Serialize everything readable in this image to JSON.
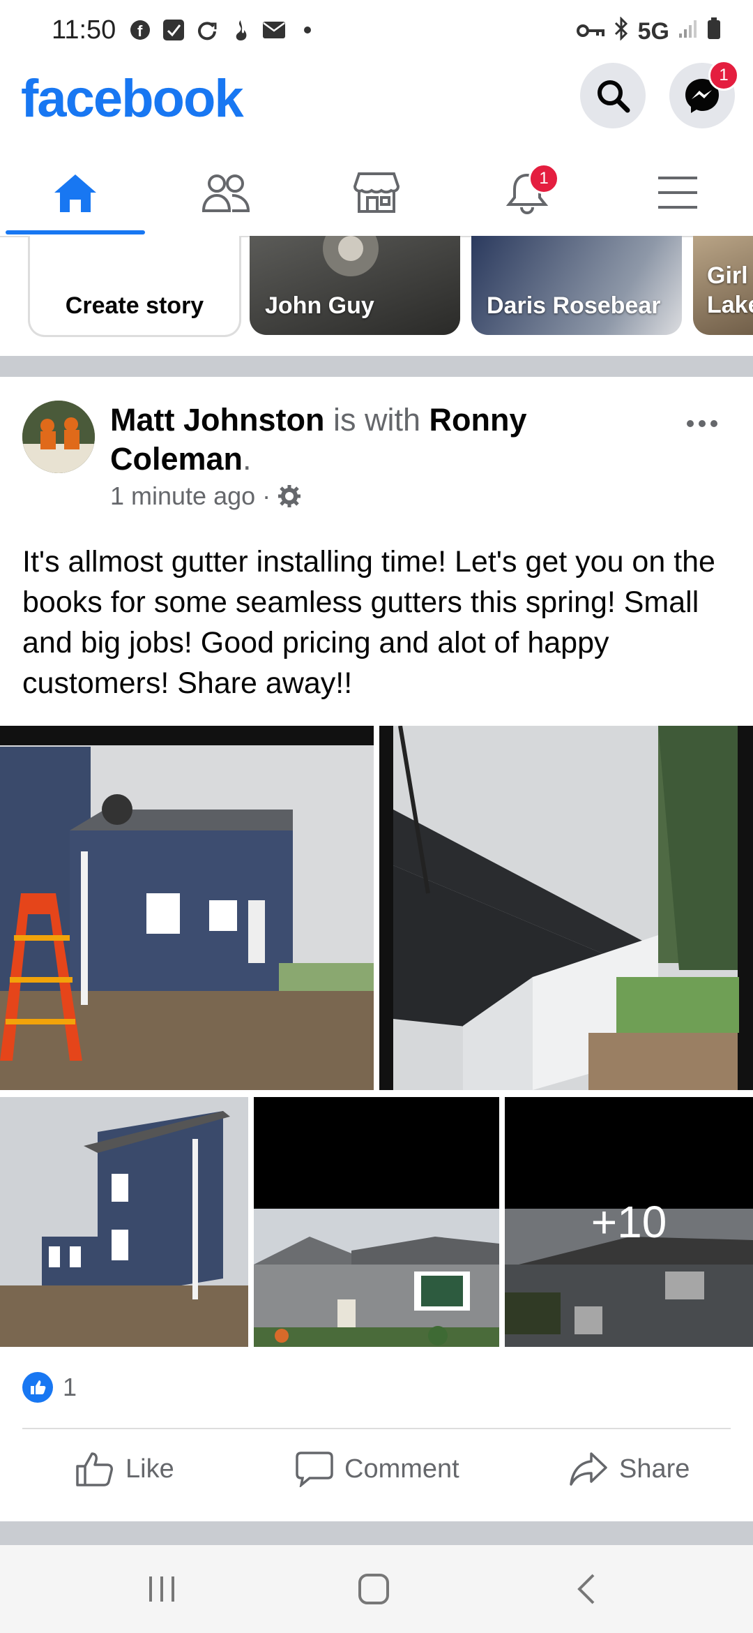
{
  "status_bar": {
    "time": "11:50",
    "network": "5G",
    "left_icons": [
      "facebook-icon",
      "call-filter-icon",
      "sync-icon",
      "fire-icon",
      "mail-icon",
      "dot-icon"
    ],
    "right_icons": [
      "vpn-key-icon",
      "bluetooth-icon",
      "signal-icon",
      "battery-icon"
    ]
  },
  "header": {
    "logo": "facebook",
    "messenger_badge": "1",
    "brand_color": "#1877f2"
  },
  "nav": {
    "tabs": [
      {
        "name": "home",
        "active": true
      },
      {
        "name": "friends",
        "active": false
      },
      {
        "name": "marketplace",
        "active": false
      },
      {
        "name": "notifications",
        "active": false,
        "badge": "1"
      },
      {
        "name": "menu",
        "active": false
      }
    ]
  },
  "stories": [
    {
      "label": "Create story"
    },
    {
      "label": "John Guy"
    },
    {
      "label": "Daris Rosebear"
    },
    {
      "label": "Girl Lake"
    }
  ],
  "post": {
    "author": "Matt Johnston",
    "with_text": "is with",
    "tagged": "Ronny Coleman",
    "period": ".",
    "time": "1 minute ago",
    "privacy_sep": "·",
    "text": "It's allmost gutter installing time! Let's get you on the books for some seamless gutters this spring! Small and big jobs! Good pricing and alot of happy customers! Share away!!",
    "more_photos": "+10",
    "reaction_count": "1",
    "actions": {
      "like": "Like",
      "comment": "Comment",
      "share": "Share"
    }
  }
}
